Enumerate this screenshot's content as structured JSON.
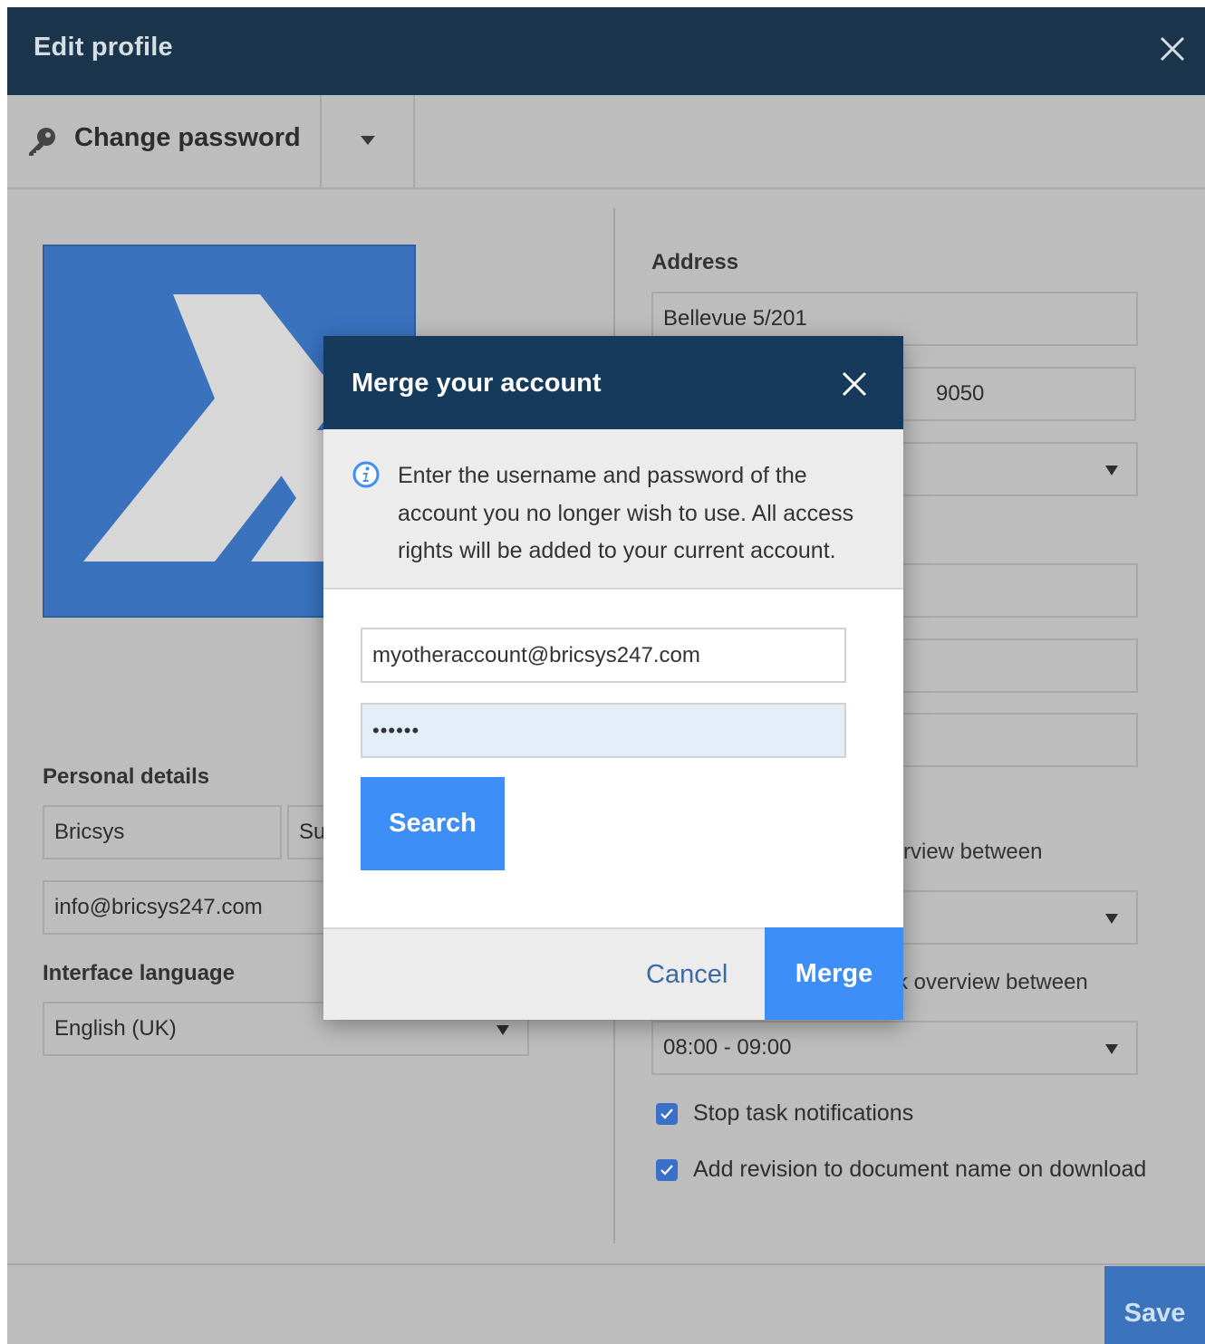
{
  "window": {
    "title": "Edit profile"
  },
  "toolbar": {
    "change_password_label": "Change password"
  },
  "personal_details": {
    "label": "Personal details",
    "first_name": "Bricsys",
    "last_name_partial": "Su",
    "email": "info@bricsys247.com"
  },
  "interface_language": {
    "label": "Interface language",
    "selected": "English (UK)"
  },
  "address": {
    "label": "Address",
    "street": "Bellevue 5/201",
    "postcode_partial": "9050"
  },
  "notifications": {
    "overview_label_1_partial": "rview between",
    "overview_label_2_partial": "k overview between",
    "time_selected": "08:00 - 09:00"
  },
  "checkboxes": [
    {
      "label": "Stop task notifications",
      "checked": true
    },
    {
      "label": "Add revision to document name on download",
      "checked": true
    }
  ],
  "footer": {
    "save_label": "Save"
  },
  "modal": {
    "title": "Merge your account",
    "info_text": "Enter the username and password of the account you no longer wish to use. All access rights will be added to your current account.",
    "username_value": "myotheraccount@bricsys247.com",
    "password_value": "••••••",
    "search_label": "Search",
    "cancel_label": "Cancel",
    "merge_label": "Merge"
  },
  "colors": {
    "header_bg": "#1b364c",
    "modal_header_bg": "#163a5c",
    "primary_button": "#3d8ff7",
    "dimmed_background": "#bdbdbd",
    "logo_blue": "#3a72be"
  }
}
